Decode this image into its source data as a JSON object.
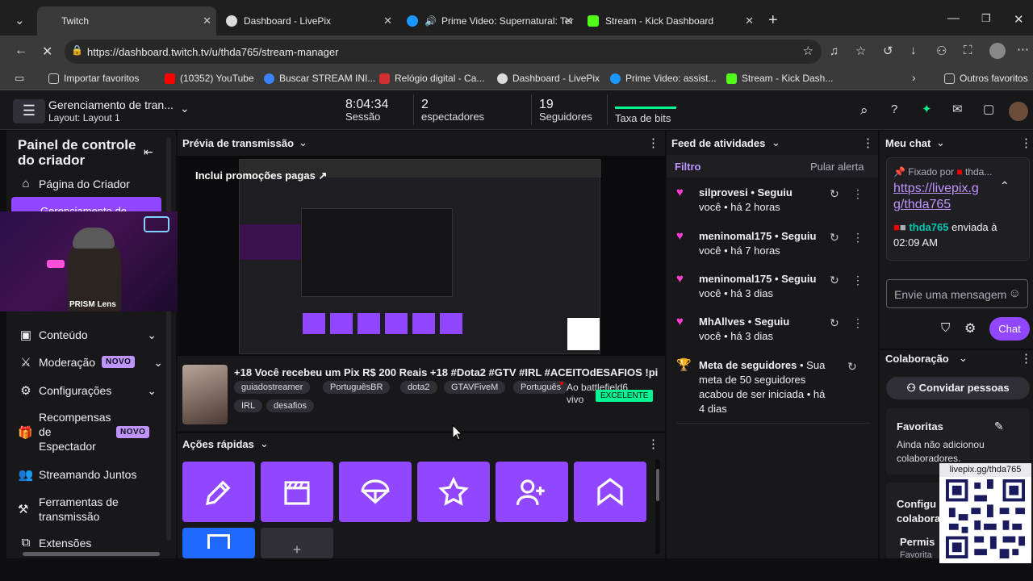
{
  "browser": {
    "tabs": [
      {
        "label": "Twitch"
      },
      {
        "label": "Dashboard - LivePix"
      },
      {
        "label": "Prime Video: Supernatural: Ter"
      },
      {
        "label": "Stream - Kick Dashboard"
      }
    ],
    "url": "https://dashboard.twitch.tv/u/thda765/stream-manager",
    "bookmarks": [
      "Importar favoritos",
      "(10352) YouTube",
      "Buscar STREAM INI...",
      "Relógio digital - Ca...",
      "Dashboard - LivePix",
      "Prime Video: assist...",
      "Stream - Kick Dash..."
    ],
    "other_bookmarks": "Outros favoritos"
  },
  "header": {
    "title": "Gerenciamento de tran...",
    "layout": "Layout: Layout 1",
    "session_value": "8:04:34",
    "session_label": "Sessão",
    "viewers_value": "2",
    "viewers_label": "espectadores",
    "followers_value": "19",
    "followers_label": "Seguidores",
    "bits_label": "Taxa de bits"
  },
  "sidebar": {
    "title_line1": "Painel de controle",
    "title_line2": "do criador",
    "items": {
      "creator_page": "Página do Criador",
      "stream_manager": "Gerenciamento de",
      "content": "Conteúdo",
      "moderation": "Moderação",
      "settings": "Configurações",
      "rewards_l1": "Recompensas",
      "rewards_l2": "de",
      "rewards_l3": "Espectador",
      "together": "Streamando Juntos",
      "tools_l1": "Ferramentas de",
      "tools_l2": "transmissão",
      "extensions": "Extensões"
    },
    "new_badge": "NOVO",
    "overlay_label": "PRISM Lens"
  },
  "preview": {
    "header": "Prévia de transmissão",
    "promo": "Inclui promoções pagas",
    "stream_title": "+18 Você recebeu um Pix R$ 200 Reais +18 #Dota2 #GTV #IRL #ACEITOdESAFIOS !pi",
    "tags": [
      "guiadostreamer",
      "PortuguêsBR",
      "dota2",
      "GTAVFiveM",
      "Português"
    ],
    "tags_row2": [
      "IRL",
      "desafios"
    ],
    "live_text_l1": "Ao battlefield6",
    "live_text_l2": "vivo",
    "quality_badge": "EXCELENTE"
  },
  "quick_actions": {
    "header": "Ações rápidas"
  },
  "activity": {
    "header": "Feed de atividades",
    "filter": "Filtro",
    "skip": "Pular alerta",
    "items": [
      {
        "user": "silprovesi",
        "action": "• Seguiu",
        "l2": "você • há 2 horas"
      },
      {
        "user": "meninomal175",
        "action": "• Seguiu",
        "l2": "você • há 7 horas"
      },
      {
        "user": "meninomal175",
        "action": "• Seguiu",
        "l2": "você • há 3 dias"
      },
      {
        "user": "MhAllves",
        "action": "• Seguiu",
        "l2": "você • há 3 dias"
      }
    ],
    "goal_title": "Meta de seguidores",
    "goal_l1": "• Sua",
    "goal_l2": "meta de 50 seguidores",
    "goal_l3": "acabou de ser iniciada • há",
    "goal_l4": "4 dias"
  },
  "chat": {
    "header": "Meu chat",
    "pinned_by": "Fixado por",
    "pinned_user_short": "thda...",
    "pinned_link_l1": "https://livepix.g",
    "pinned_link_l2": "g/thda765",
    "sender": "thda765",
    "sent_l1": "enviada à",
    "sent_l2": "02:09 AM",
    "input_placeholder": "Envie uma mensagem",
    "chat_button": "Chat"
  },
  "collab": {
    "header": "Colaboração",
    "invite": "Convidar pessoas",
    "fav_title": "Favoritas",
    "fav_l1": "Ainda não adicionou",
    "fav_l2": "colaboradores.",
    "config_l1": "Configu",
    "config_l2": "colabora",
    "perm_l1": "Permis",
    "perm_l2": "Favorita",
    "qr_label": "livepix.gg/thda765"
  },
  "colors": {
    "accent": "#9147ff",
    "badge": "#bf94ff",
    "live_green": "#00f593",
    "follow_heart": "#eb0400"
  }
}
